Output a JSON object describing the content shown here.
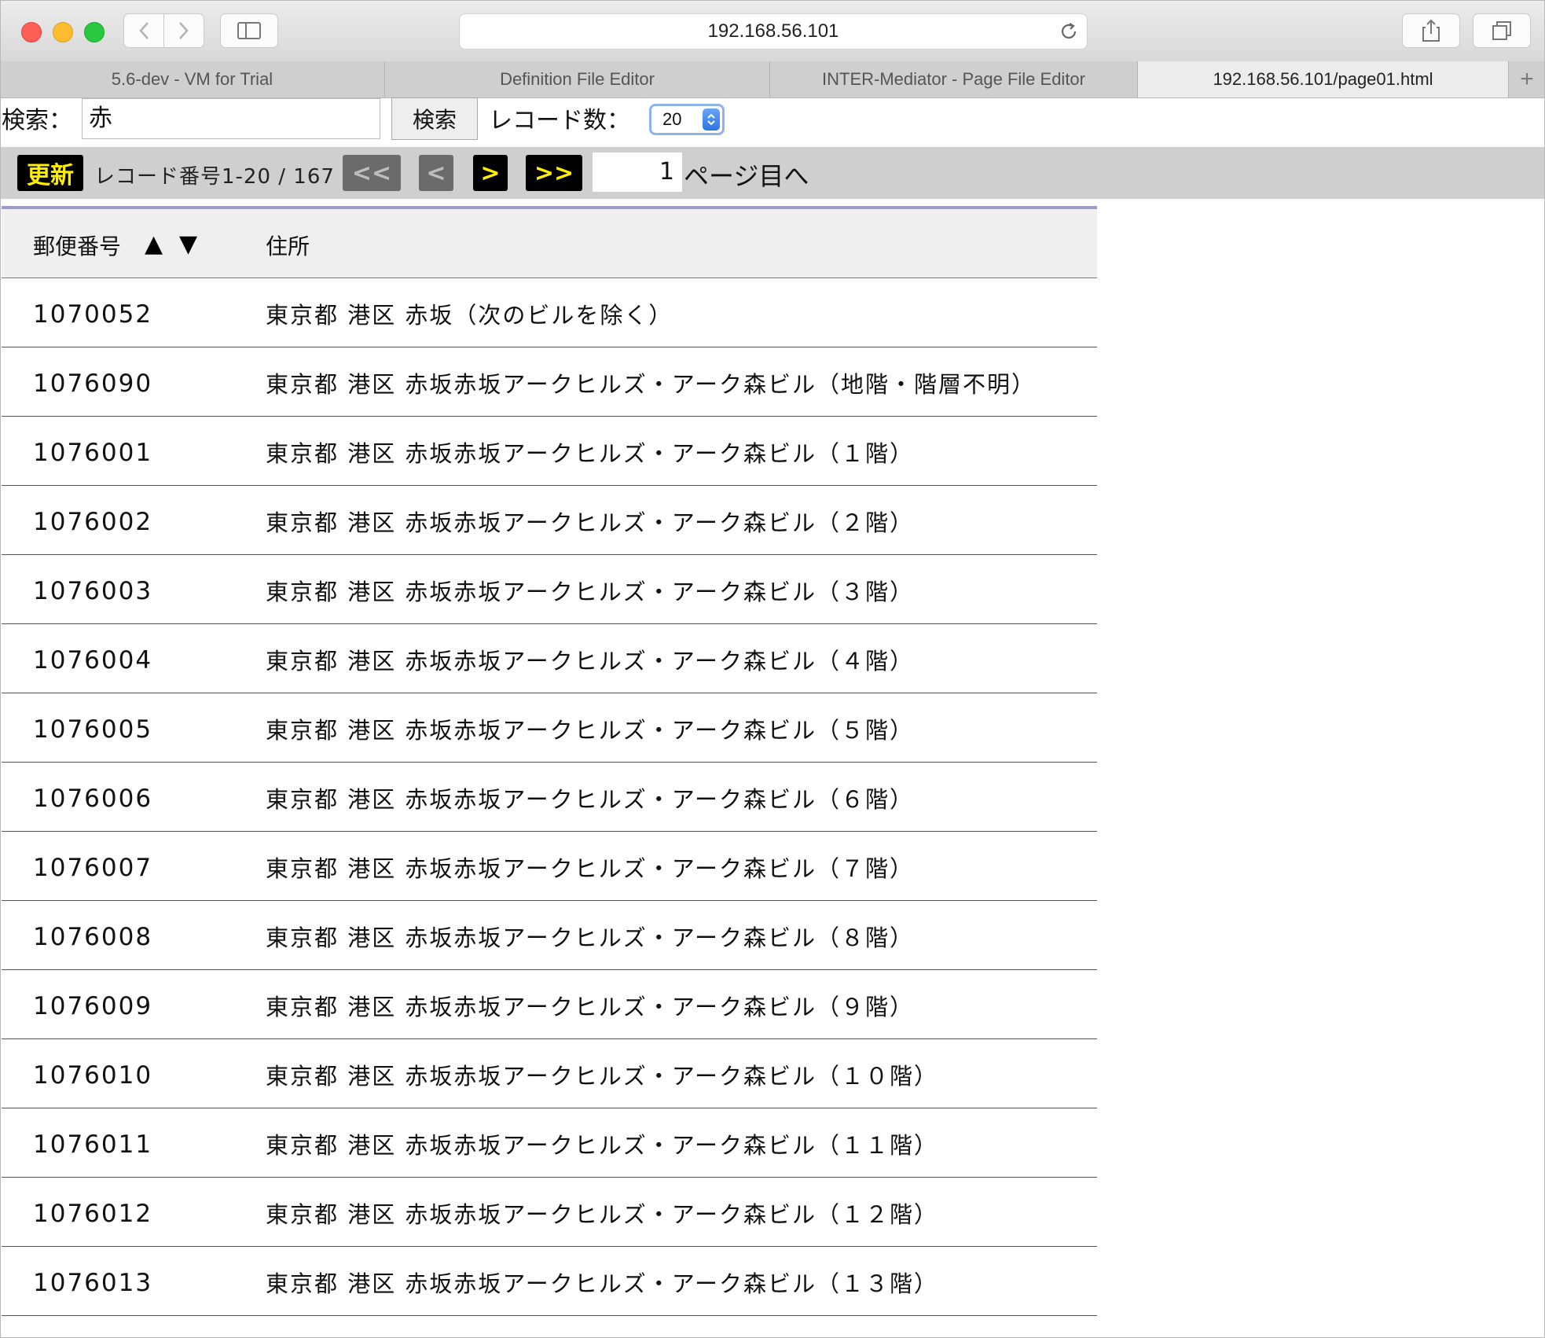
{
  "browser": {
    "address": "192.168.56.101",
    "tabs": [
      {
        "label": "5.6-dev - VM for Trial",
        "active": false
      },
      {
        "label": "Definition File Editor",
        "active": false
      },
      {
        "label": "INTER-Mediator - Page File Editor",
        "active": false
      },
      {
        "label": "192.168.56.101/page01.html",
        "active": true
      }
    ],
    "new_tab_label": "+"
  },
  "search": {
    "label": "検索：",
    "value": "赤",
    "button_label": "検索",
    "record_count_label": "レコード数：",
    "record_count_value": "20"
  },
  "navigator": {
    "refresh_label": "更新",
    "record_info": "レコード番号1-20 / 167",
    "first_label": "<<",
    "prev_label": "<",
    "next_label": ">",
    "last_label": ">>",
    "page_value": "1",
    "page_suffix": "ページ目へ"
  },
  "table": {
    "headers": {
      "zip": "郵便番号",
      "sort_asc": "▲",
      "sort_desc": "▼",
      "address": "住所"
    },
    "rows": [
      {
        "zip": "1070052",
        "address": "東京都 港区 赤坂（次のビルを除く）"
      },
      {
        "zip": "1076090",
        "address": "東京都 港区 赤坂赤坂アークヒルズ・アーク森ビル（地階・階層不明）"
      },
      {
        "zip": "1076001",
        "address": "東京都 港区 赤坂赤坂アークヒルズ・アーク森ビル（１階）"
      },
      {
        "zip": "1076002",
        "address": "東京都 港区 赤坂赤坂アークヒルズ・アーク森ビル（２階）"
      },
      {
        "zip": "1076003",
        "address": "東京都 港区 赤坂赤坂アークヒルズ・アーク森ビル（３階）"
      },
      {
        "zip": "1076004",
        "address": "東京都 港区 赤坂赤坂アークヒルズ・アーク森ビル（４階）"
      },
      {
        "zip": "1076005",
        "address": "東京都 港区 赤坂赤坂アークヒルズ・アーク森ビル（５階）"
      },
      {
        "zip": "1076006",
        "address": "東京都 港区 赤坂赤坂アークヒルズ・アーク森ビル（６階）"
      },
      {
        "zip": "1076007",
        "address": "東京都 港区 赤坂赤坂アークヒルズ・アーク森ビル（７階）"
      },
      {
        "zip": "1076008",
        "address": "東京都 港区 赤坂赤坂アークヒルズ・アーク森ビル（８階）"
      },
      {
        "zip": "1076009",
        "address": "東京都 港区 赤坂赤坂アークヒルズ・アーク森ビル（９階）"
      },
      {
        "zip": "1076010",
        "address": "東京都 港区 赤坂赤坂アークヒルズ・アーク森ビル（１０階）"
      },
      {
        "zip": "1076011",
        "address": "東京都 港区 赤坂赤坂アークヒルズ・アーク森ビル（１１階）"
      },
      {
        "zip": "1076012",
        "address": "東京都 港区 赤坂赤坂アークヒルズ・アーク森ビル（１２階）"
      },
      {
        "zip": "1076013",
        "address": "東京都 港区 赤坂赤坂アークヒルズ・アーク森ビル（１３階）"
      }
    ]
  },
  "colors": {
    "accent_border": "#9a9acc",
    "nav_yellow": "#ffee00",
    "nav_bg": "#cfcfcf"
  }
}
